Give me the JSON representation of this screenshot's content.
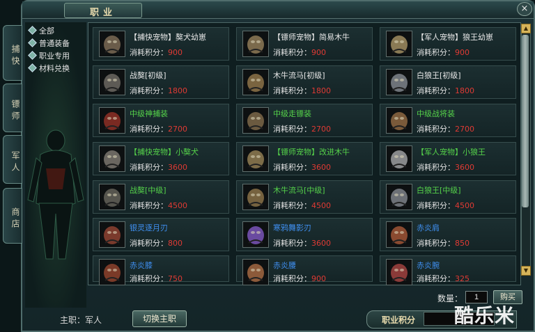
{
  "window": {
    "title": "职业",
    "close": "×"
  },
  "tabs": [
    {
      "label": "捕快"
    },
    {
      "label": "镖师"
    },
    {
      "label": "军人"
    },
    {
      "label": "商店"
    }
  ],
  "categories": [
    {
      "label": "全部"
    },
    {
      "label": "普通装备"
    },
    {
      "label": "职业专用"
    },
    {
      "label": "材料兑换"
    }
  ],
  "cost_label": "消耗积分：",
  "items": [
    {
      "name": "【捕快宠物】獒犬幼崽",
      "cost": "900",
      "name_color": "#e8e8e8",
      "icon": "dog-pup-icon"
    },
    {
      "name": "【镖师宠物】简易木牛",
      "cost": "900",
      "name_color": "#e8e8e8",
      "icon": "wooden-ox-icon"
    },
    {
      "name": "【军人宠物】狼王幼崽",
      "cost": "900",
      "name_color": "#e8e8e8",
      "icon": "wolf-pup-icon"
    },
    {
      "name": "战獒[初级]",
      "cost": "1800",
      "name_color": "#e8e8e8",
      "icon": "war-mastiff-icon"
    },
    {
      "name": "木牛流马[初级]",
      "cost": "1800",
      "name_color": "#e8e8e8",
      "icon": "wooden-ox-horse-icon"
    },
    {
      "name": "白狼王[初级]",
      "cost": "1800",
      "name_color": "#e8e8e8",
      "icon": "white-wolf-icon"
    },
    {
      "name": "中级神捕装",
      "cost": "2700",
      "name_color": "#55d24a",
      "icon": "catcher-armor-icon"
    },
    {
      "name": "中级走镖装",
      "cost": "2700",
      "name_color": "#55d24a",
      "icon": "escort-armor-icon"
    },
    {
      "name": "中级战将装",
      "cost": "2700",
      "name_color": "#55d24a",
      "icon": "general-armor-icon"
    },
    {
      "name": "【捕快宠物】小獒犬",
      "cost": "3600",
      "name_color": "#55d24a",
      "icon": "mastiff-icon"
    },
    {
      "name": "【镖师宠物】改进木牛",
      "cost": "3600",
      "name_color": "#55d24a",
      "icon": "improved-ox-icon"
    },
    {
      "name": "【军人宠物】小狼王",
      "cost": "3600",
      "name_color": "#55d24a",
      "icon": "little-wolf-icon"
    },
    {
      "name": "战獒[中级]",
      "cost": "4500",
      "name_color": "#55d24a",
      "icon": "war-mastiff-mid-icon"
    },
    {
      "name": "木牛流马[中级]",
      "cost": "4500",
      "name_color": "#55d24a",
      "icon": "wooden-ox-horse-mid-icon"
    },
    {
      "name": "白狼王[中级]",
      "cost": "4500",
      "name_color": "#55d24a",
      "icon": "white-wolf-mid-icon"
    },
    {
      "name": "银灵逐月刃",
      "cost": "800",
      "name_color": "#3f8ff0",
      "icon": "moon-blade-icon"
    },
    {
      "name": "寒鸦舞影刃",
      "cost": "3600",
      "name_color": "#3f8ff0",
      "icon": "raven-blade-icon"
    },
    {
      "name": "赤炎肩",
      "cost": "850",
      "name_color": "#3f8ff0",
      "icon": "flame-shoulder-icon"
    },
    {
      "name": "赤炎膝",
      "cost": "750",
      "name_color": "#3f8ff0",
      "icon": "flame-knee-icon"
    },
    {
      "name": "赤炎腰",
      "cost": "900",
      "name_color": "#3f8ff0",
      "icon": "flame-waist-icon"
    },
    {
      "name": "赤炎腕",
      "cost": "325",
      "name_color": "#3f8ff0",
      "icon": "flame-wrist-icon"
    }
  ],
  "footer": {
    "quantity_label": "数量：",
    "quantity_value": "1",
    "buy_label": "购买",
    "main_job": "主职：军人",
    "switch_label": "切换主职",
    "points_label": "职业积分"
  },
  "watermark": "酷乐米",
  "colors": {
    "cost": "#e03a34",
    "gold_text": "#e9dcae"
  }
}
